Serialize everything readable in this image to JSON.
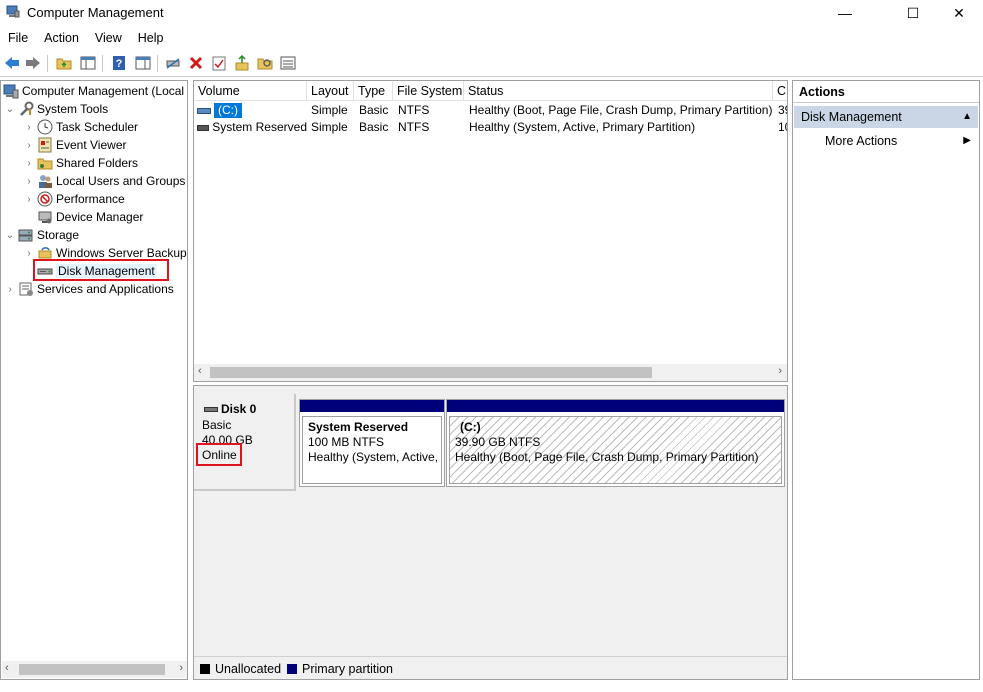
{
  "window": {
    "title": "Computer Management",
    "controls": [
      "—",
      "☐",
      "✕"
    ]
  },
  "menu": [
    "File",
    "Action",
    "View",
    "Help"
  ],
  "tree": {
    "root": "Computer Management (Local",
    "system_tools": "System Tools",
    "task_scheduler": "Task Scheduler",
    "event_viewer": "Event Viewer",
    "shared_folders": "Shared Folders",
    "local_users": "Local Users and Groups",
    "performance": "Performance",
    "device_manager": "Device Manager",
    "storage": "Storage",
    "wsb": "Windows Server Backup",
    "disk_management": "Disk Management",
    "services": "Services and Applications"
  },
  "list": {
    "columns": [
      "Volume",
      "Layout",
      "Type",
      "File System",
      "Status",
      "C"
    ],
    "rows": [
      [
        "(C:)",
        "Simple",
        "Basic",
        "NTFS",
        "Healthy (Boot, Page File, Crash Dump, Primary Partition)",
        "39"
      ],
      [
        "System Reserved",
        "Simple",
        "Basic",
        "NTFS",
        "Healthy (System, Active, Primary Partition)",
        "10"
      ]
    ]
  },
  "disk": {
    "name": "Disk 0",
    "type": "Basic",
    "size": "40.00 GB",
    "state": "Online",
    "partitions": [
      {
        "name": "System Reserved",
        "size": "100 MB NTFS",
        "status": "Healthy (System, Active,"
      },
      {
        "name": "(C:)",
        "size": "39.90 GB NTFS",
        "status": "Healthy (Boot, Page File, Crash Dump, Primary Partition)"
      }
    ]
  },
  "legend": {
    "unallocated": "Unallocated",
    "primary": "Primary partition",
    "colors": {
      "unallocated": "#000000",
      "primary": "#00007b"
    }
  },
  "actions": {
    "header": "Actions",
    "section": "Disk Management",
    "more": "More Actions"
  },
  "colors": {
    "selection": "#cad6e5",
    "highlight": "#e0141e",
    "volume_selected": "#0078d7"
  }
}
